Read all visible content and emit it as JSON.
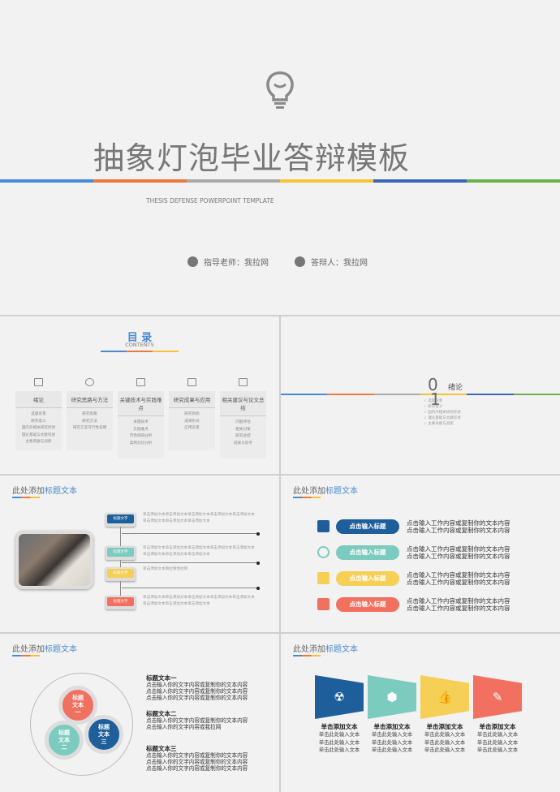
{
  "colors": {
    "blue": "#4a8bd0",
    "orange": "#e97b3c",
    "gray": "#a9a9a9",
    "yellow": "#f3c43a",
    "navy": "#3b67b5",
    "green": "#6ab04c",
    "dark_blue": "#1e5f9b",
    "teal": "#7ccbbf",
    "gold": "#f6cf57",
    "coral": "#f2705f"
  },
  "cover": {
    "title": "抽象灯泡毕业答辩模板",
    "subtitle": "THESIS DEFENSE POWERPOINT TEMPLATE",
    "advisor": "指导老师：我拉网",
    "defender": "答辩人：我拉网",
    "icons": [
      "lightbulb-icon",
      "user-icon",
      "microphone-icon"
    ]
  },
  "toc": {
    "title": "目 录",
    "subtitle": "CONTENTS",
    "columns": [
      {
        "icon": "book-icon",
        "head": "绪论",
        "items": [
          "选题背景",
          "研究意义",
          "国内外相关研究综述",
          "理论基础与文献综述",
          "主要贡献与创新"
        ]
      },
      {
        "icon": "search-icon",
        "head": "研究思路与方法",
        "items": [
          "研究思路",
          "研究方法",
          "研究方案可行性说明"
        ]
      },
      {
        "icon": "compass-icon",
        "head": "关键技术与实践难点",
        "items": [
          "关键技术",
          "实践难点",
          "市场调研分析",
          "案例对比分析"
        ]
      },
      {
        "icon": "microscope-icon",
        "head": "研究成果与应用",
        "items": [
          "研究目标",
          "成果形式",
          "应用前景"
        ]
      },
      {
        "icon": "monitor-icon",
        "head": "相关建议与论文总结",
        "items": [
          "问题评估",
          "相关对策",
          "研究总结",
          "成果与思考"
        ]
      }
    ]
  },
  "section": {
    "num_a": "0",
    "num_b": "1",
    "title": "绪论",
    "items": [
      "选题背景",
      "研究意义",
      "国内外相关研究综述",
      "理论基础与文献综述",
      "主要贡献与创新"
    ]
  },
  "slide_title": {
    "prefix": "此处添加",
    "highlight": "标题文本"
  },
  "timeline": {
    "items": [
      {
        "label": "标题文字",
        "text": "单击添加文本单击添加文本单击添加文本单击添加文本单击添加文本单击添加文本单击添加文本单击添加文本"
      },
      {
        "label": "标题文字",
        "text": "单击添加文本单击添加文本单击添加文本单击添加文本单击添加文本单击添加文本单击添加文本单击添加文本"
      },
      {
        "label": "标题文字",
        "text": "单击添加文本我拉网我拉网"
      },
      {
        "label": "标题文字",
        "text": "单击添加文本单击添加文本单击添加文本单击添加文本单击添加文本单击添加文本单击添加文本单击添加文本"
      }
    ]
  },
  "pills": {
    "items": [
      {
        "icon": "briefcase-icon",
        "label": "点击输入标题",
        "line1": "点击输入工作内容或复制你的文本内容",
        "line2": "点击输入工作内容或复制你的文本内容"
      },
      {
        "icon": "clock-icon",
        "label": "点击输入标题",
        "line1": "点击输入工作内容或复制你的文本内容",
        "line2": "点击输入工作内容或复制你的文本内容"
      },
      {
        "icon": "chart-trend-icon",
        "label": "点击输入标题",
        "line1": "点击输入工作内容或复制你的文本内容",
        "line2": "点击输入工作内容或复制你的文本内容"
      },
      {
        "icon": "team-icon",
        "label": "点击输入标题",
        "line1": "点击输入工作内容或复制你的文本内容",
        "line2": "点击输入工作内容或复制你的文本内容"
      }
    ]
  },
  "circles": {
    "c1": [
      "标题",
      "文本",
      "一"
    ],
    "c2": [
      "标题",
      "文本",
      "二"
    ],
    "c3": [
      "标题",
      "文本",
      "三"
    ],
    "blocks": [
      {
        "title": "标题文本一",
        "lines": [
          "点击输入你的文字内容或复制你的文本内容",
          "点击输入你的文字内容或复制你的文本内容",
          "点击输入你的文字内容或复制你的文本内容"
        ]
      },
      {
        "title": "标题文本二",
        "lines": [
          "点击输入你的文字内容或复制你的文本内容",
          "点击输入你的文字内容或我拉网"
        ]
      },
      {
        "title": "标题文本三",
        "lines": [
          "点击输入你的文字内容或复制你的文本内容",
          "点击输入你的文字内容或复制你的文本内容",
          "点击输入你的文字内容或复制你的文本内容"
        ]
      }
    ]
  },
  "flags": {
    "items": [
      {
        "icon": "radiation-icon",
        "title": "单击添加文本",
        "lines": [
          "单击此处输入文本",
          "单击此处输入文本",
          "单击此处输入文本"
        ]
      },
      {
        "icon": "cube-icon",
        "title": "单击添加文本",
        "lines": [
          "单击此处输入文本",
          "单击此处输入文本",
          "单击此处输入文本"
        ]
      },
      {
        "icon": "thumbs-up-icon",
        "title": "单击添加文本",
        "lines": [
          "单击此处输入文本",
          "单击此处输入文本",
          "单击此处输入文本"
        ]
      },
      {
        "icon": "pencil-icon",
        "title": "单击添加文本",
        "lines": [
          "单击此处输入文本",
          "单击此处输入文本",
          "单击此处输入文本"
        ]
      }
    ]
  }
}
